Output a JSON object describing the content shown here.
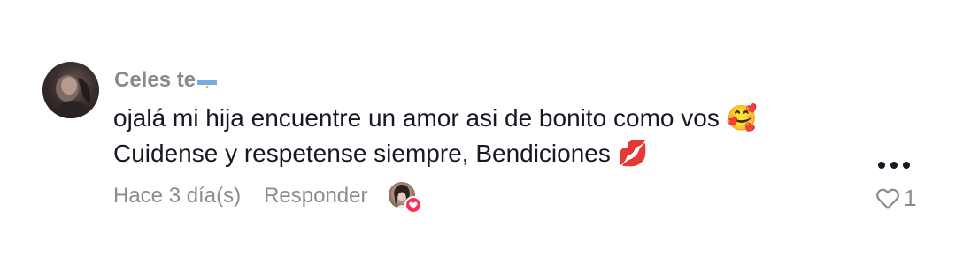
{
  "comment": {
    "username": "Celes te",
    "user_flag_icon": "argentina-flag-icon",
    "lines": [
      "ojalá mi hija encuentre un amor asi de bonito como vos",
      "Cuidense y respetense siempre, Bendiciones"
    ],
    "line_emojis": [
      "🥰",
      "💋"
    ],
    "timestamp": "Hace 3 día(s)",
    "reply_label": "Responder",
    "like_count": "1"
  },
  "colors": {
    "text_primary": "#161823",
    "text_secondary": "#8a8b91",
    "accent": "#fe2c55"
  }
}
